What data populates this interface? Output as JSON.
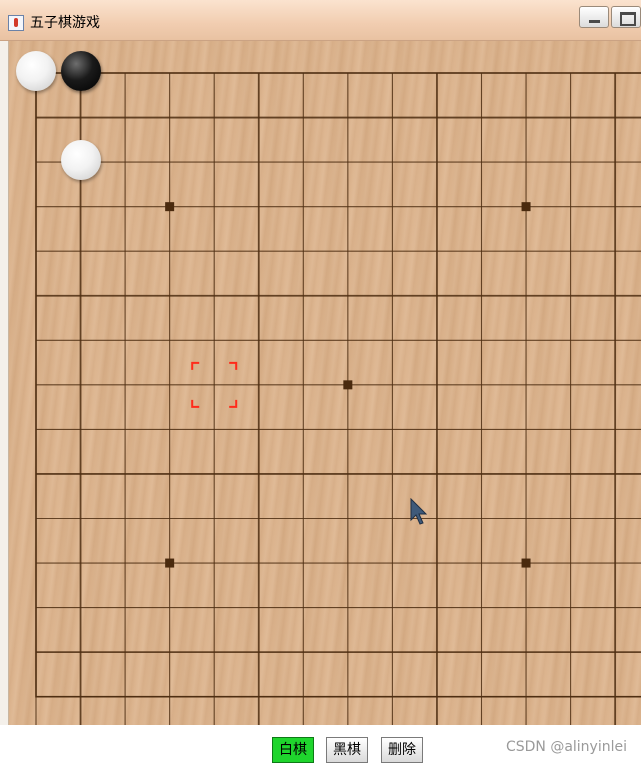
{
  "window": {
    "title": "五子棋游戏",
    "icon": "java-cup-icon"
  },
  "board": {
    "grid_lines": 15,
    "star_points": [
      [
        3,
        3
      ],
      [
        11,
        3
      ],
      [
        7,
        7
      ],
      [
        3,
        11
      ],
      [
        11,
        11
      ]
    ],
    "stones": [
      {
        "color": "white",
        "col": 0,
        "row": 0
      },
      {
        "color": "black",
        "col": 1,
        "row": 0
      },
      {
        "color": "white",
        "col": 1,
        "row": 2
      }
    ],
    "marker": {
      "col": 4,
      "row": 7,
      "color": "#ff2a1a"
    },
    "line_color": "#4e2e12",
    "star_color": "#4a2a0e"
  },
  "toolbar": {
    "white_label": "白棋",
    "black_label": "黑棋",
    "delete_label": "删除",
    "active_color": "#1fd52d"
  },
  "watermark": "CSDN @alinyinlei"
}
